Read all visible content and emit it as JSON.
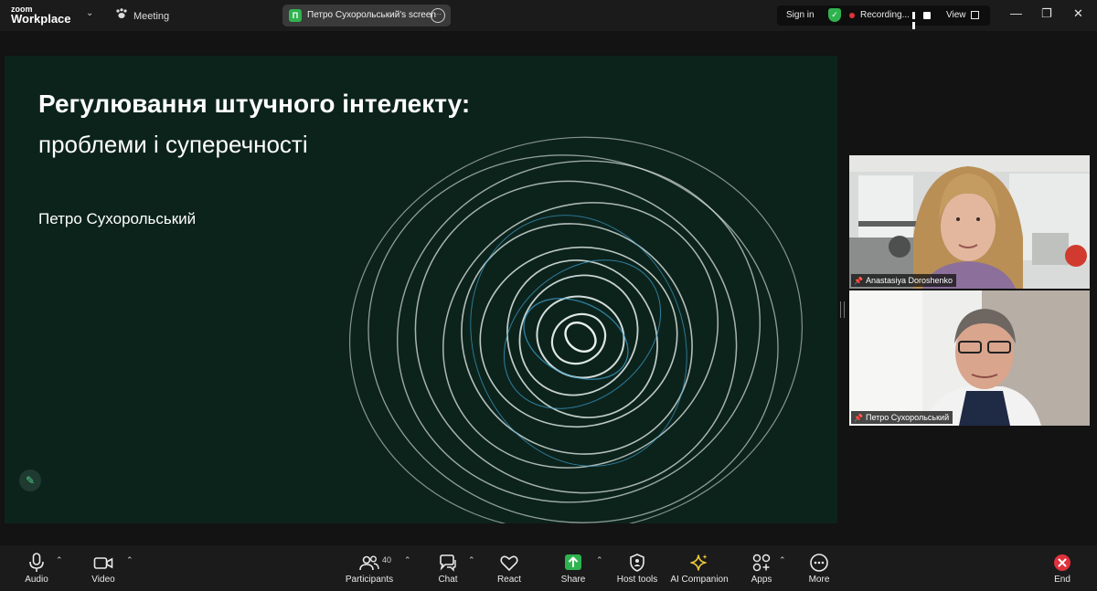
{
  "app": {
    "logo_line1": "zoom",
    "logo_line2": "Workplace",
    "meeting_label": "Meeting"
  },
  "share": {
    "badge_letter": "П",
    "screen_name": "Петро Сухорольський's screen"
  },
  "top_right": {
    "sign_in": "Sign in",
    "recording": "Recording...",
    "view": "View"
  },
  "slide": {
    "title": "Регулювання штучного інтелекту:",
    "subtitle": "проблеми і суперечності",
    "author": "Петро Сухорольський"
  },
  "participants": [
    {
      "name": "Anastasiya Doroshenko"
    },
    {
      "name": "Петро Сухорольський"
    }
  ],
  "toolbar": {
    "audio": "Audio",
    "video": "Video",
    "participants": "Participants",
    "participants_count": "40",
    "chat": "Chat",
    "react": "React",
    "share": "Share",
    "host_tools": "Host tools",
    "ai_companion": "AI Companion",
    "apps": "Apps",
    "more": "More",
    "end": "End"
  },
  "colors": {
    "slide_bg": "#0c231c",
    "share_green": "#2fb34f",
    "active_speaker_border": "#37d36a",
    "end_red": "#e0323c"
  }
}
